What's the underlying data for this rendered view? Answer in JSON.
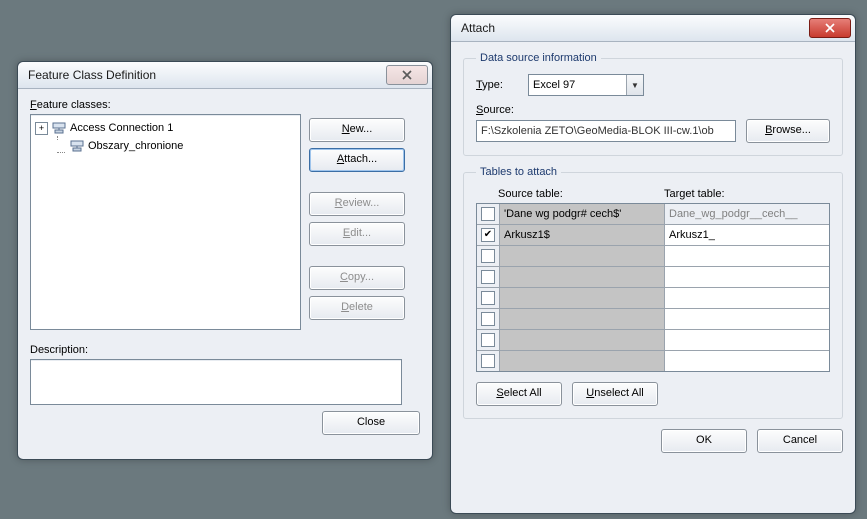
{
  "fcd": {
    "title": "Feature Class Definition",
    "feature_classes_label": "Feature classes:",
    "tree": {
      "root": "Access Connection 1",
      "child": "Obszary_chronione"
    },
    "buttons": {
      "new": "New...",
      "attach": "Attach...",
      "review": "Review...",
      "edit": "Edit...",
      "copy": "Copy...",
      "delete": "Delete"
    },
    "description_label": "Description:",
    "close": "Close"
  },
  "attach": {
    "title": "Attach",
    "group1": {
      "legend": "Data source information",
      "type_label": "Type:",
      "type_value": "Excel 97",
      "source_label": "Source:",
      "source_value": "F:\\Szkolenia ZETO\\GeoMedia-BLOK III-cw.1\\ob",
      "browse": "Browse..."
    },
    "group2": {
      "legend": "Tables to attach",
      "source_header": "Source table:",
      "target_header": "Target table:",
      "rows": [
        {
          "checked": false,
          "source": "'Dane wg podgr# cech$'",
          "target": "Dane_wg_podgr__cech__",
          "target_disabled": true
        },
        {
          "checked": true,
          "source": "Arkusz1$",
          "target": "Arkusz1_",
          "target_disabled": false
        },
        {
          "checked": false,
          "source": "",
          "target": "",
          "target_disabled": false
        },
        {
          "checked": false,
          "source": "",
          "target": "",
          "target_disabled": false
        },
        {
          "checked": false,
          "source": "",
          "target": "",
          "target_disabled": false
        },
        {
          "checked": false,
          "source": "",
          "target": "",
          "target_disabled": false
        },
        {
          "checked": false,
          "source": "",
          "target": "",
          "target_disabled": false
        },
        {
          "checked": false,
          "source": "",
          "target": "",
          "target_disabled": false
        }
      ],
      "select_all": "Select All",
      "unselect_all": "Unselect All"
    },
    "ok": "OK",
    "cancel": "Cancel"
  }
}
